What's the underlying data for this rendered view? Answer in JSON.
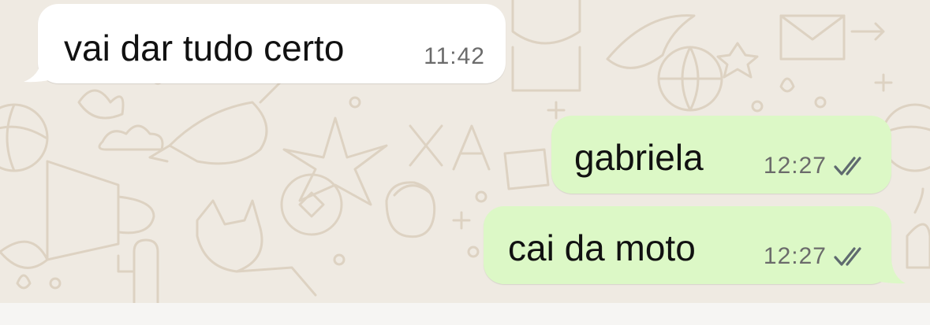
{
  "conversation": {
    "messages": [
      {
        "direction": "incoming",
        "text": "vai dar tudo certo",
        "time": "11:42"
      },
      {
        "direction": "outgoing",
        "text": "gabriela",
        "time": "12:27",
        "status": "read"
      },
      {
        "direction": "outgoing",
        "text": "cai da moto",
        "time": "12:27",
        "status": "read"
      }
    ]
  },
  "icons": {
    "read_receipt": "double-check-icon"
  },
  "colors": {
    "chat_background": "#efeae2",
    "incoming_bubble": "#ffffff",
    "outgoing_bubble": "#dcf8c6",
    "doodle_stroke": "#ddd2c2",
    "timestamp": "#6b6b6b",
    "read_check": "#5f6a6f"
  }
}
